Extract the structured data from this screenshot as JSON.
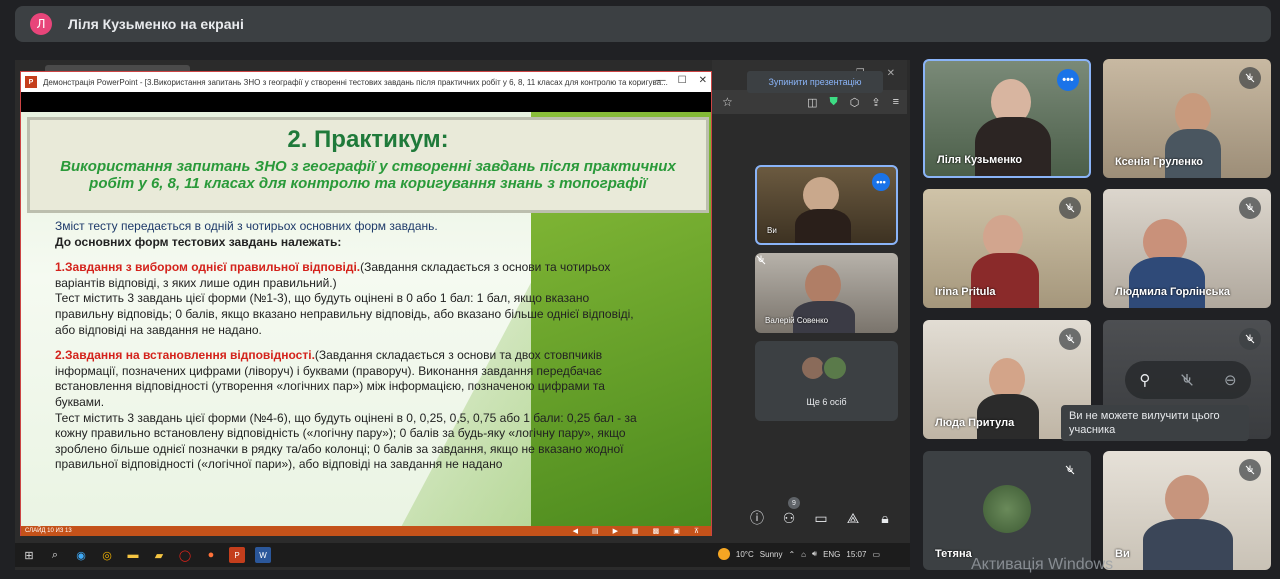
{
  "header": {
    "avatar_letter": "Л",
    "title": "Ліля Кузьменко на екрані"
  },
  "ppt": {
    "window_title": "Демонстрація PowerPoint - [3.Використання запитань ЗНО з географії у створенні тестових завдань після практичних робіт у 6, 8, 11 класах для контролю та коригува...",
    "icon_label": "P",
    "controls": {
      "minimize": "—",
      "maximize": "☐",
      "close": "✕"
    },
    "slide": {
      "title": "2. Практикум:",
      "subtitle": "Використання запитань ЗНО з географії у створенні завдань після практичних робіт у 6, 8, 11 класах для контролю та коригування знань з топографії",
      "intro": "Зміст тесту передається в одній з чотирьох основних форм завдань.",
      "bold_line": "До основних форм тестових завдань належать:",
      "p1_red": "1.Завдання з вибором однієї правильної відповіді.",
      "p1_text": "(Завдання складається з основи та чотирьох варіантів відповіді, з яких лише один правильний.)",
      "p1_more": "Тест містить 3 завдань цієї форми (№1-3), що будуть оцінені в 0 або 1 бал: 1 бал, якщо вказано правильну відповідь; 0 балів, якщо вказано неправильну відповідь, або вказано більше однієї відповіді, або відповіді на завдання не надано.",
      "p2_red": "2.Завдання на встановлення відповідності.",
      "p2_text": "(Завдання складається з основи та двох стовпчиків інформації, позначених цифрами (ліворуч) і буквами (праворуч). Виконання завдання передбачає встановлення відповідності (утворення «логічних пар») між інформацією, позначеною цифрами та буквами.",
      "p2_more": "Тест містить 3 завдань цієї форми (№4-6), що будуть оцінені в 0, 0,25, 0,5, 0,75 або 1 бали: 0,25 бал - за кожну правильно встановлену відповідність («логічну пару»); 0 балів за будь-яку «логічну пару», якщо зроблено більше однієї позначки в рядку та/або колонці; 0 балів за завдання, якщо не вказано жодної правильної відповідності («логічної пари»), або відповіді на завдання не надано"
    },
    "status_text": "СЛАЙД 10 ИЗ 13"
  },
  "browser": {
    "stop_presenting": "Зупинити презентацію"
  },
  "side_tiles": {
    "self_name": "Ви",
    "valeriy": "Валерій Совенко",
    "more_label": "Ще 6 осіб"
  },
  "participants": [
    {
      "name": "Ліля Кузьменко"
    },
    {
      "name": "Ксенія Груленко"
    },
    {
      "name": "Irina Pritula"
    },
    {
      "name": "Людмила Горлінська"
    },
    {
      "name": "Люда Притула"
    },
    {
      "name": "Тетяна"
    },
    {
      "name": "Ви"
    }
  ],
  "controls": {
    "people_badge": "9"
  },
  "tooltip": "Ви не можете вилучити цього учасника",
  "taskbar": {
    "temp": "10°C",
    "weather": "Sunny",
    "lang": "ENG",
    "time": "15:07"
  },
  "activation": "Активація Windows",
  "colors": {
    "accent": "#1a73e8",
    "slide_title": "#1f7a3a",
    "slide_red": "#d4231c",
    "ppt_status": "#c4521a"
  }
}
